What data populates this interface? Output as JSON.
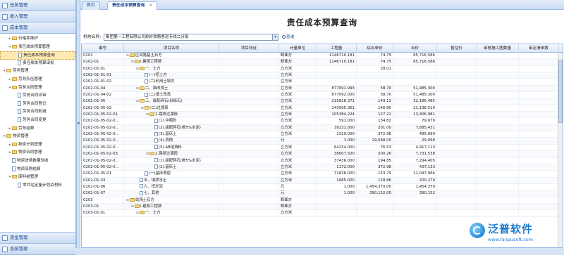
{
  "sidebar": {
    "top_sections": [
      "任务管理",
      "收入管理",
      "成本管理"
    ],
    "tree": [
      {
        "label": "价格库维护",
        "level": 1,
        "folder": true,
        "toggle": "▸"
      },
      {
        "label": "责任成本预算管理",
        "level": 1,
        "folder": true,
        "toggle": "▾"
      },
      {
        "label": "责任成本预算查询",
        "level": 2,
        "folder": false,
        "selected": true
      },
      {
        "label": "责任成本预算审批",
        "level": 2,
        "folder": false
      },
      {
        "label": "劳务管理",
        "level": 0,
        "folder": true,
        "toggle": "▾"
      },
      {
        "label": "劳务队伍管理",
        "level": 1,
        "folder": true,
        "toggle": "▸"
      },
      {
        "label": "劳务合同管理",
        "level": 1,
        "folder": true,
        "toggle": "▾"
      },
      {
        "label": "劳务合同评审",
        "level": 2,
        "folder": false
      },
      {
        "label": "劳务合同登记",
        "level": 2,
        "folder": false
      },
      {
        "label": "劳务合同削减",
        "level": 2,
        "folder": false
      },
      {
        "label": "劳务合同变更",
        "level": 2,
        "folder": false
      },
      {
        "label": "劳务结算",
        "level": 1,
        "folder": true,
        "toggle": "▸"
      },
      {
        "label": "物资管理",
        "level": 0,
        "folder": true,
        "toggle": "▾"
      },
      {
        "label": "物资计划管理",
        "level": 1,
        "folder": true,
        "toggle": "▸"
      },
      {
        "label": "物资合同管理",
        "level": 1,
        "folder": true,
        "toggle": "▸"
      },
      {
        "label": "物资进场数量验收",
        "level": 1,
        "folder": false
      },
      {
        "label": "物资采购结算",
        "level": 1,
        "folder": false
      },
      {
        "label": "废料结管理",
        "level": 1,
        "folder": true,
        "toggle": "▾"
      },
      {
        "label": "零件站定量计划及材料",
        "level": 2,
        "folder": false
      },
      {
        "label": "资金管理",
        "level": 0,
        "folder": true,
        "toggle": "▸",
        "as_section": true
      }
    ],
    "bottom_sections": [
      "资金管理",
      "系统管理"
    ]
  },
  "tabs": [
    {
      "label": "首页",
      "active": false
    },
    {
      "label": "责任成本预算查询",
      "active": true,
      "close": "×"
    }
  ],
  "page_title": "责任成本预算查询",
  "filter": {
    "label": "机构名称:",
    "value": "集团第一工程有限公司岭岭铁路客运专线二分部",
    "query_label": "查询"
  },
  "columns": [
    "编号",
    "项目名称",
    "项目特征",
    "计量单位",
    "工程量",
    "综合单价",
    "合价",
    "暂估价",
    "审核施工图数量",
    "审定清单数"
  ],
  "rows": [
    {
      "code": "0202",
      "name": "区间路基土石方",
      "indent": 0,
      "folder": true,
      "unit": "断面方",
      "qty": "1146710.181",
      "price": "74.75",
      "total": "85,716,586"
    },
    {
      "code": "0202-01",
      "name": "I.建筑工程费",
      "indent": 1,
      "folder": true,
      "unit": "断面方",
      "qty": "1146710.181",
      "price": "74.75",
      "total": "85,716,586"
    },
    {
      "code": "0202-01-01",
      "name": "一、土方",
      "indent": 2,
      "folder": true,
      "unit": "立方米",
      "qty": "",
      "price": "28.01",
      "total": ""
    },
    {
      "code": "0202-01-01-01",
      "name": "(一)挖土方",
      "indent": 3,
      "folder": false,
      "unit": "立方米",
      "qty": "",
      "price": "",
      "total": ""
    },
    {
      "code": "0202-01-01-02",
      "name": "(二)利用土填方",
      "indent": 3,
      "folder": false,
      "unit": "立方米",
      "qty": "",
      "price": "",
      "total": ""
    },
    {
      "code": "0202-01-04",
      "name": "二、填改良土",
      "indent": 2,
      "folder": true,
      "unit": "立方米",
      "qty": "877091.993",
      "price": "58.70",
      "total": "51,485,300"
    },
    {
      "code": "0202-01-04-02",
      "name": "(二)填土改良",
      "indent": 3,
      "folder": false,
      "unit": "立方米",
      "qty": "877092.000",
      "price": "58.70",
      "total": "51,485,300"
    },
    {
      "code": "0202-01-05",
      "name": "三、级配碎石(砂砾石)",
      "indent": 2,
      "folder": true,
      "unit": "立方米",
      "qty": "215828.371",
      "price": "149.13",
      "total": "32,186,485"
    },
    {
      "code": "0202-01-05-02",
      "name": "(二)过渡段",
      "indent": 3,
      "folder": true,
      "unit": "立方米",
      "qty": "143995.361",
      "price": "146.80",
      "total": "21,138,519"
    },
    {
      "code": "0202-01-05-02-01",
      "name": "1.路桥过渡段",
      "indent": 4,
      "folder": true,
      "unit": "立方米",
      "qty": "105384.224",
      "price": "127.22",
      "total": "13,406,981"
    },
    {
      "code": "0202-01-05-02-0...",
      "name": "(1).中粗砂",
      "indent": 5,
      "folder": false,
      "unit": "立方米",
      "qty": "591.000",
      "price": "134.82",
      "total": "79,679"
    },
    {
      "code": "0202-01-05-02-0...",
      "name": "(2).级配碎石(掺5%水泥)",
      "indent": 5,
      "folder": false,
      "unit": "立方米",
      "qty": "39231.000",
      "price": "201.00",
      "total": "7,885,431"
    },
    {
      "code": "0202-01-05-02-0...",
      "name": "(3).基床土",
      "indent": 5,
      "folder": false,
      "unit": "立方米",
      "qty": "1329.000",
      "price": "372.98",
      "total": "495,690"
    },
    {
      "code": "0202-01-05-02-0...",
      "name": "(4).其他",
      "indent": 5,
      "folder": false,
      "unit": "元",
      "qty": "1.000",
      "price": "29,068.00",
      "total": "29,068"
    },
    {
      "code": "0202-01-05-02-0...",
      "name": "(5).AB组填料",
      "indent": 5,
      "folder": false,
      "unit": "立方米",
      "qty": "64234.000",
      "price": "76.53",
      "total": "4,917,113"
    },
    {
      "code": "0202-01-05-02-03",
      "name": "2.路堤过渡段",
      "indent": 4,
      "folder": true,
      "unit": "立方米",
      "qty": "38607.500",
      "price": "200.26",
      "total": "7,731,538"
    },
    {
      "code": "0202-01-05-02-0...",
      "name": "(1).级配碎石(掺5%水泥)",
      "indent": 5,
      "folder": false,
      "unit": "立方米",
      "qty": "37436.000",
      "price": "194.85",
      "total": "7,294,405"
    },
    {
      "code": "0202-01-05-02-0...",
      "name": "(2).基床土",
      "indent": 5,
      "folder": false,
      "unit": "立方米",
      "qty": "1172.000",
      "price": "372.98",
      "total": "437,133"
    },
    {
      "code": "0202-01-05-01",
      "name": "(一)基床表层",
      "indent": 3,
      "folder": false,
      "unit": "立方米",
      "qty": "71838.000",
      "price": "153.79",
      "total": "11,047,966"
    },
    {
      "code": "0202-01-03",
      "name": "五、填渗水土",
      "indent": 2,
      "folder": false,
      "unit": "立方米",
      "qty": "1685.000",
      "price": "118.86",
      "total": "200,279"
    },
    {
      "code": "0202-01-06",
      "name": "六、挖淤泥",
      "indent": 2,
      "folder": false,
      "unit": "元",
      "qty": "1.000",
      "price": "1,454,370.00",
      "total": "1,454,370"
    },
    {
      "code": "0202-01-07",
      "name": "七、其他",
      "indent": 2,
      "folder": false,
      "unit": "元",
      "qty": "1.000",
      "price": "390,152.00",
      "total": "390,152"
    },
    {
      "code": "0203",
      "name": "站场土石方",
      "indent": 0,
      "folder": true,
      "unit": "断面方",
      "qty": "",
      "price": "",
      "total": ""
    },
    {
      "code": "0203-01",
      "name": "I.建筑工程费",
      "indent": 1,
      "folder": true,
      "unit": "断面方",
      "qty": "",
      "price": "",
      "total": ""
    },
    {
      "code": "0203-01-01",
      "name": "一、土方",
      "indent": 2,
      "folder": true,
      "unit": "立方米",
      "qty": "",
      "price": "",
      "total": ""
    }
  ],
  "logo": {
    "name": "泛普软件",
    "url": "www.fanpusoft.com"
  },
  "colors": {
    "accent": "#15428b",
    "border": "#99bbe8",
    "selection": "#fde9b2",
    "logo": "#1a7bd1"
  }
}
